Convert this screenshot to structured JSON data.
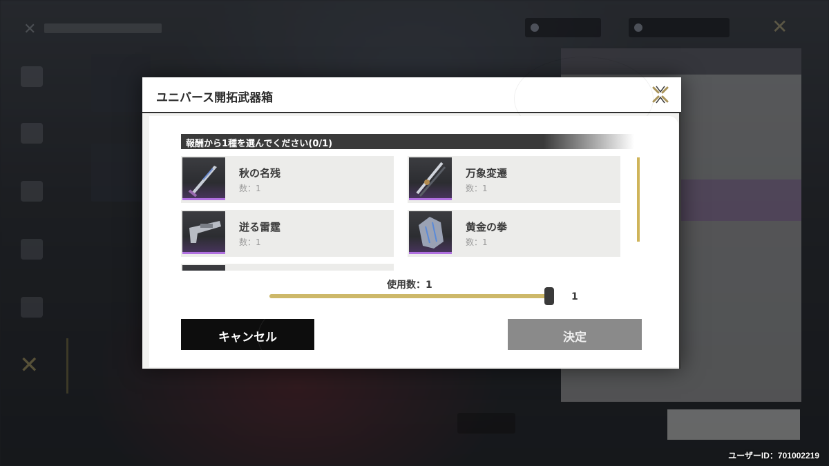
{
  "background": {
    "user_id": "ユーザーID：701002219"
  },
  "modal": {
    "title": "ユニバース開拓武器箱",
    "close_icon": "close-x-icon",
    "prompt": "報酬から1種を選んでください(0/1)",
    "items": [
      {
        "name": "秋の名残",
        "qty": "数：1",
        "icon": "sword-icon",
        "rarity_color": "#b070e0"
      },
      {
        "name": "万象変遷",
        "qty": "数：1",
        "icon": "katana-icon",
        "rarity_color": "#b070e0"
      },
      {
        "name": "迸る雷霆",
        "qty": "数：1",
        "icon": "gun-icon",
        "rarity_color": "#b070e0"
      },
      {
        "name": "黄金の拳",
        "qty": "数：1",
        "icon": "gauntlet-icon",
        "rarity_color": "#b070e0"
      }
    ],
    "use_count_label": "使用数：1",
    "slider": {
      "value": "1",
      "fraction": 1.0
    },
    "cancel_label": "キャンセル",
    "confirm_label": "決定"
  },
  "colors": {
    "accent_gold": "#cdb869",
    "rarity_purple": "#b070e0",
    "cancel_bg": "#0d0d0d",
    "confirm_bg": "#8a8a8a"
  }
}
